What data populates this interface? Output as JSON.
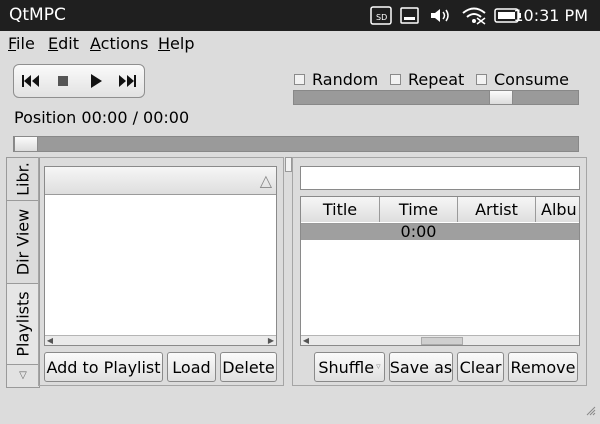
{
  "statusbar": {
    "app_title": "QtMPC",
    "time": "10:31 PM",
    "icons": [
      "sd-card-icon",
      "screen-icon",
      "volume-icon",
      "wifi-icon",
      "battery-icon"
    ]
  },
  "menu": {
    "file": "File",
    "edit": "Edit",
    "actions": "Actions",
    "help": "Help"
  },
  "player": {
    "icons": [
      "previous-icon",
      "stop-icon",
      "play-icon",
      "next-icon"
    ]
  },
  "options": {
    "random": "Random",
    "repeat": "Repeat",
    "consume": "Consume",
    "random_checked": false,
    "repeat_checked": false,
    "consume_checked": false
  },
  "volume": {
    "level": 0.75
  },
  "position": {
    "label": "Position 00:00 / 00:00",
    "progress": 0
  },
  "side_tabs": {
    "library": "Libr.",
    "dir_view": "Dir View",
    "playlists": "Playlists",
    "active": "playlists"
  },
  "playlists_panel": {
    "add_to_playlist": "Add to Playlist",
    "load": "Load",
    "delete": "Delete"
  },
  "playqueue": {
    "search_value": "",
    "columns": [
      "Title",
      "Time",
      "Artist",
      "Albu"
    ],
    "rows": [
      {
        "title": "",
        "time": "0:00",
        "artist": "",
        "album": ""
      }
    ],
    "shuffle": "Shuffle",
    "save_as": "Save as",
    "clear": "Clear",
    "remove": "Remove"
  }
}
